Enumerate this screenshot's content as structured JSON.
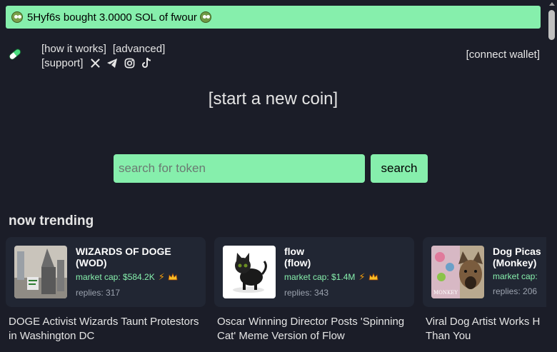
{
  "ticker": {
    "text": "5Hyf6s bought 3.0000 SOL of fwour"
  },
  "nav": {
    "how_it_works": "[how it works]",
    "advanced": "[advanced]",
    "support": "[support]",
    "connect_wallet": "[connect wallet]"
  },
  "hero": {
    "start_coin": "[start a new coin]"
  },
  "search": {
    "placeholder": "search for token",
    "button": "search"
  },
  "trending": {
    "title": "now trending",
    "cards": [
      {
        "name_line1": "WIZARDS OF DOGE",
        "name_line2": "(WOD)",
        "market_cap": "market cap: $584.2K",
        "replies": "replies: 317",
        "headline_line1": "DOGE Activist Wizards Taunt Protestors",
        "headline_line2": "in Washington DC"
      },
      {
        "name_line1": "flow",
        "name_line2": "(flow)",
        "market_cap": "market cap: $1.4M",
        "replies": "replies: 343",
        "headline_line1": "Oscar Winning Director Posts 'Spinning",
        "headline_line2": "Cat' Meme Version of Flow"
      },
      {
        "name_line1": "Dog Picas",
        "name_line2": "(Monkey)",
        "market_cap": "market cap:",
        "replies": "replies: 206",
        "headline_line1": "Viral Dog Artist Works H",
        "headline_line2": "Than You",
        "image_caption": "MONKEY"
      }
    ]
  },
  "colors": {
    "background": "#1b1d28",
    "accent": "#86efac",
    "card": "#212633"
  }
}
